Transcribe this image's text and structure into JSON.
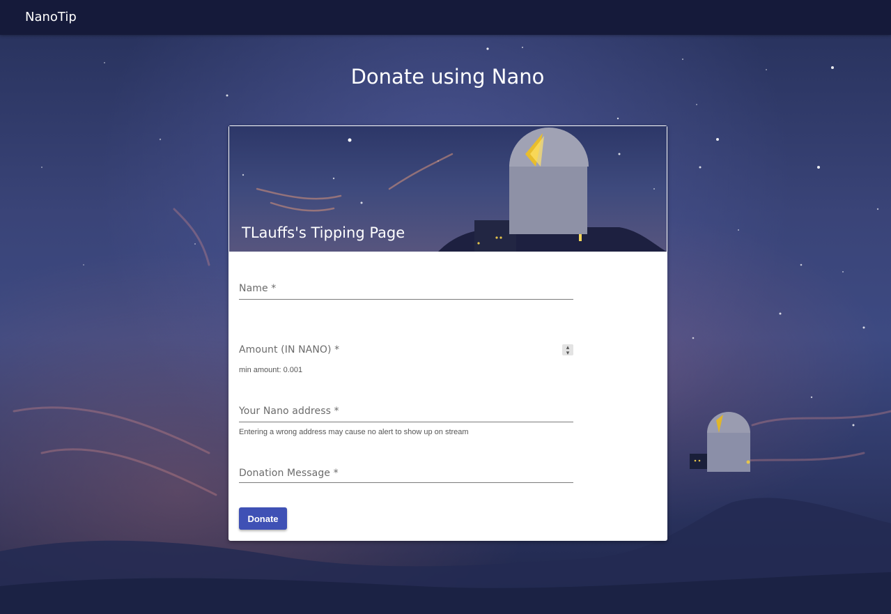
{
  "navbar": {
    "brand": "NanoTip"
  },
  "page": {
    "title": "Donate using Nano"
  },
  "card": {
    "title": "TLauffs's Tipping Page",
    "fields": {
      "name": {
        "label": "Name *",
        "value": ""
      },
      "amount": {
        "label": "Amount (IN NANO) *",
        "value": "",
        "hint": "min amount: 0.001"
      },
      "address": {
        "label": "Your Nano address *",
        "value": "",
        "hint": "Entering a wrong address may cause no alert to show up on stream"
      },
      "message": {
        "label": "Donation Message *",
        "value": ""
      }
    },
    "donate_label": "Donate"
  },
  "colors": {
    "navbar": "#151a3a",
    "accent": "#3f51b5",
    "card_bg": "#ffffff",
    "background": "#3a4478"
  },
  "icons": {
    "spinner": "number-stepper-icon"
  }
}
